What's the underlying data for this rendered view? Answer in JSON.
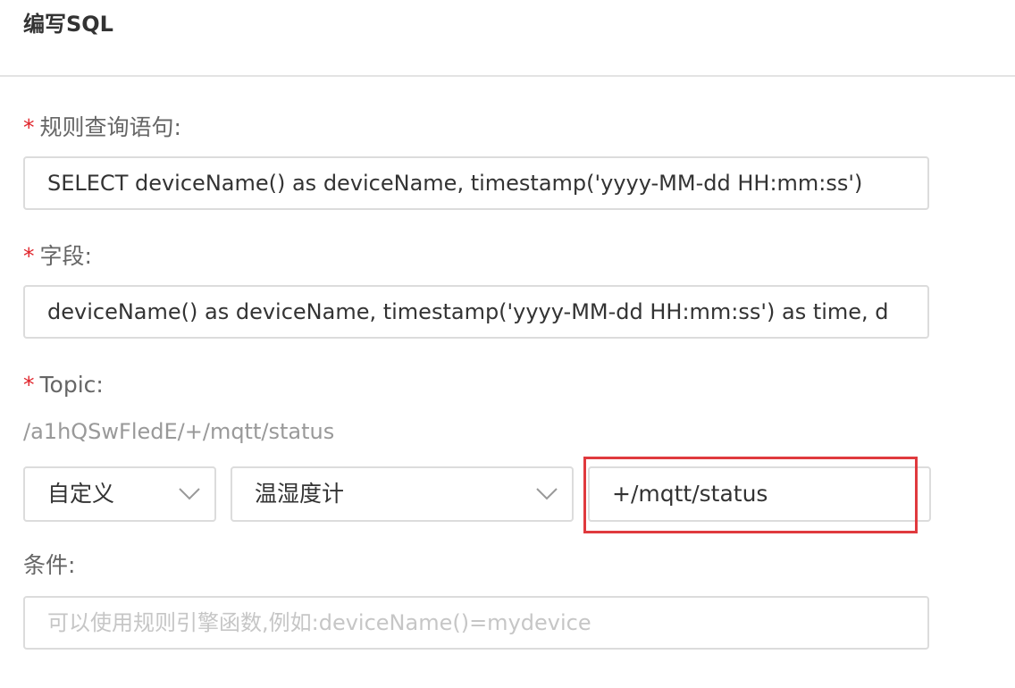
{
  "panel": {
    "title": "编写SQL"
  },
  "form": {
    "required_mark": "*",
    "query": {
      "label": "规则查询语句:",
      "value": "SELECT deviceName() as deviceName, timestamp('yyyy-MM-dd HH:mm:ss')"
    },
    "fields": {
      "label": "字段:",
      "value": "deviceName() as deviceName, timestamp('yyyy-MM-dd HH:mm:ss') as time, d"
    },
    "topic": {
      "label": "Topic:",
      "prefix": "/a1hQSwFledE/+/mqtt/status",
      "type_select": "自定义",
      "product_select": "温湿度计",
      "topic_value": "+/mqtt/status"
    },
    "condition": {
      "label": "条件:",
      "placeholder": "可以使用规则引擎函数,例如:deviceName()=mydevice"
    }
  },
  "colors": {
    "required": "#e0242b",
    "highlight_border": "#e03a3e",
    "input_border": "#dcdcdc"
  },
  "icons": {
    "dropdown": "chevron-down-icon"
  }
}
